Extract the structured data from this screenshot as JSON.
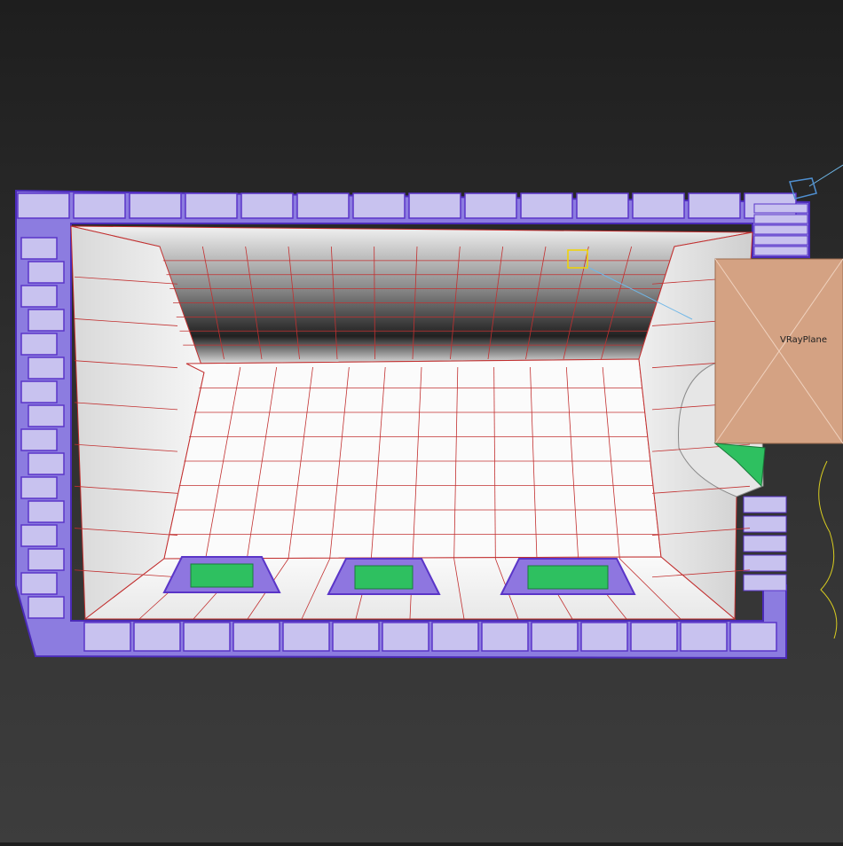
{
  "viewport": {
    "name": "perspective-viewport",
    "background_top": "#1e1e1e",
    "background_bottom": "#3d3d3d"
  },
  "scene": {
    "room_wireframe_color": "#c23030",
    "frame_wireframe_color": "#5a35c8",
    "window_glass_color": "#2ec060",
    "surface_color": "#ecebeb",
    "plane_color": "#d4a283",
    "window_count": 3
  },
  "objects": {
    "vray_plane_label": "VRayPlane"
  }
}
